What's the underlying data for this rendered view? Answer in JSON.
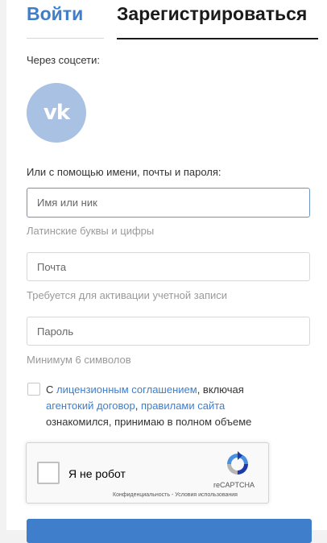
{
  "tabs": {
    "login": "Войти",
    "register": "Зарегистрироваться"
  },
  "social": {
    "label": "Через соцсети:",
    "vk_text": "vk",
    "vk_color": "#a9c1e2"
  },
  "form": {
    "alt_label": "Или с помощью имени, почты и пароля:",
    "name": {
      "placeholder": "Имя или ник",
      "value": "",
      "hint": "Латинские буквы и цифры"
    },
    "email": {
      "placeholder": "Почта",
      "value": "",
      "hint": "Требуется для активации учетной записи"
    },
    "password": {
      "placeholder": "Пароль",
      "value": "",
      "hint": "Минимум 6 символов"
    }
  },
  "agreement": {
    "prefix": "С",
    "license_link": "лицензионным соглашением",
    "middle": ", включая",
    "agency_link": "агентокий договор",
    "comma": ",",
    "rules_link": "правилами сайта",
    "suffix": "ознакомился, принимаю в полном объеме"
  },
  "captcha": {
    "label": "Я не робот",
    "brand": "reCAPTCHA",
    "links": "Конфиденциальность - Условия использования"
  },
  "colors": {
    "accent": "#3e7ecb",
    "text_dark": "#1a1a1a",
    "hint": "#9a9a9a"
  }
}
